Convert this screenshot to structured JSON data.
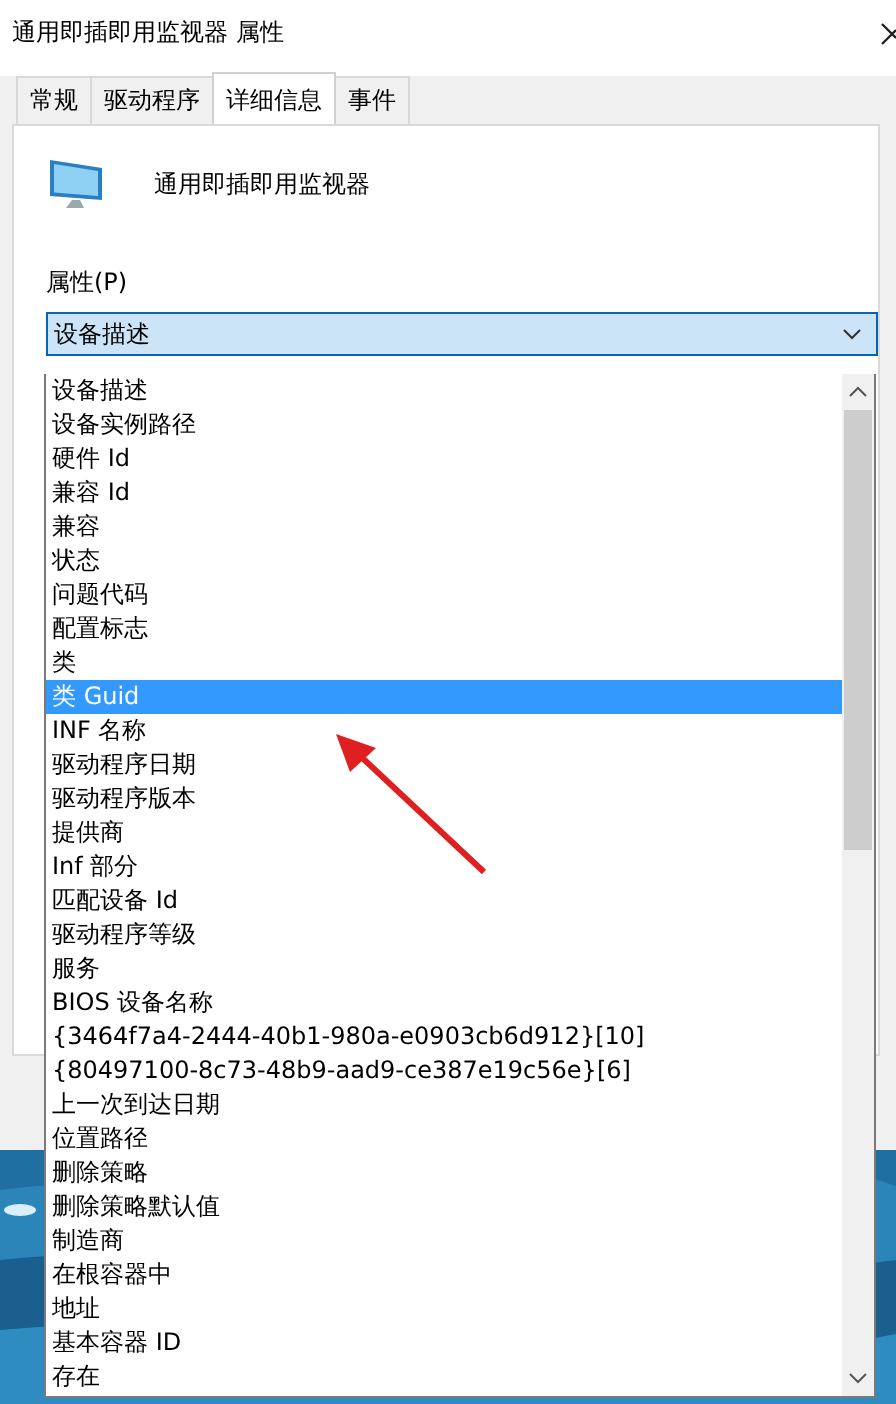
{
  "window": {
    "title": "通用即插即用监视器 属性"
  },
  "tabs": [
    {
      "label": "常规",
      "selected": false
    },
    {
      "label": "驱动程序",
      "selected": false
    },
    {
      "label": "详细信息",
      "selected": true
    },
    {
      "label": "事件",
      "selected": false
    }
  ],
  "device": {
    "name": "通用即插即用监视器"
  },
  "property": {
    "label": "属性(P)",
    "value": "设备描述"
  },
  "dropdown": {
    "items": [
      {
        "label": "设备描述",
        "selected": false
      },
      {
        "label": "设备实例路径",
        "selected": false
      },
      {
        "label": "硬件 Id",
        "selected": false
      },
      {
        "label": "兼容 Id",
        "selected": false
      },
      {
        "label": "兼容",
        "selected": false
      },
      {
        "label": "状态",
        "selected": false
      },
      {
        "label": "问题代码",
        "selected": false
      },
      {
        "label": "配置标志",
        "selected": false
      },
      {
        "label": "类",
        "selected": false
      },
      {
        "label": "类 Guid",
        "selected": true
      },
      {
        "label": "INF 名称",
        "selected": false
      },
      {
        "label": "驱动程序日期",
        "selected": false
      },
      {
        "label": "驱动程序版本",
        "selected": false
      },
      {
        "label": "提供商",
        "selected": false
      },
      {
        "label": "Inf 部分",
        "selected": false
      },
      {
        "label": "匹配设备 Id",
        "selected": false
      },
      {
        "label": "驱动程序等级",
        "selected": false
      },
      {
        "label": "服务",
        "selected": false
      },
      {
        "label": "BIOS 设备名称",
        "selected": false
      },
      {
        "label": "{3464f7a4-2444-40b1-980a-e0903cb6d912}[10]",
        "selected": false
      },
      {
        "label": "{80497100-8c73-48b9-aad9-ce387e19c56e}[6]",
        "selected": false
      },
      {
        "label": "上一次到达日期",
        "selected": false
      },
      {
        "label": "位置路径",
        "selected": false
      },
      {
        "label": "删除策略",
        "selected": false
      },
      {
        "label": "删除策略默认值",
        "selected": false
      },
      {
        "label": "制造商",
        "selected": false
      },
      {
        "label": "在根容器中",
        "selected": false
      },
      {
        "label": "地址",
        "selected": false
      },
      {
        "label": "基本容器 ID",
        "selected": false
      },
      {
        "label": "存在",
        "selected": false
      }
    ]
  }
}
